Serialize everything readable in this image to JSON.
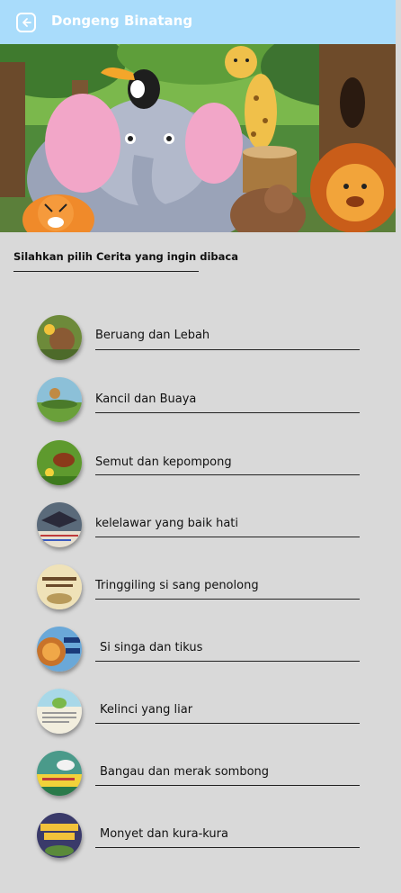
{
  "appbar": {
    "title": "Dongeng Binatang",
    "back_icon": "back-arrow-icon"
  },
  "banner": {
    "description_icon": "animal-jungle-illustration"
  },
  "prompt": {
    "text": "Silahkan pilih Cerita yang ingin dibaca"
  },
  "stories": [
    {
      "label": "Beruang dan Lebah"
    },
    {
      "label": "Kancil dan Buaya"
    },
    {
      "label": "Semut dan kepompong"
    },
    {
      "label": "kelelawar yang baik hati"
    },
    {
      "label": "Tringgiling si sang penolong"
    },
    {
      "label": "Si singa dan tikus"
    },
    {
      "label": "Kelinci yang liar"
    },
    {
      "label": "Bangau dan merak sombong"
    },
    {
      "label": "Monyet dan kura-kura"
    }
  ],
  "colors": {
    "appbar": "#a9dcfb",
    "background": "#d9d9d9"
  }
}
